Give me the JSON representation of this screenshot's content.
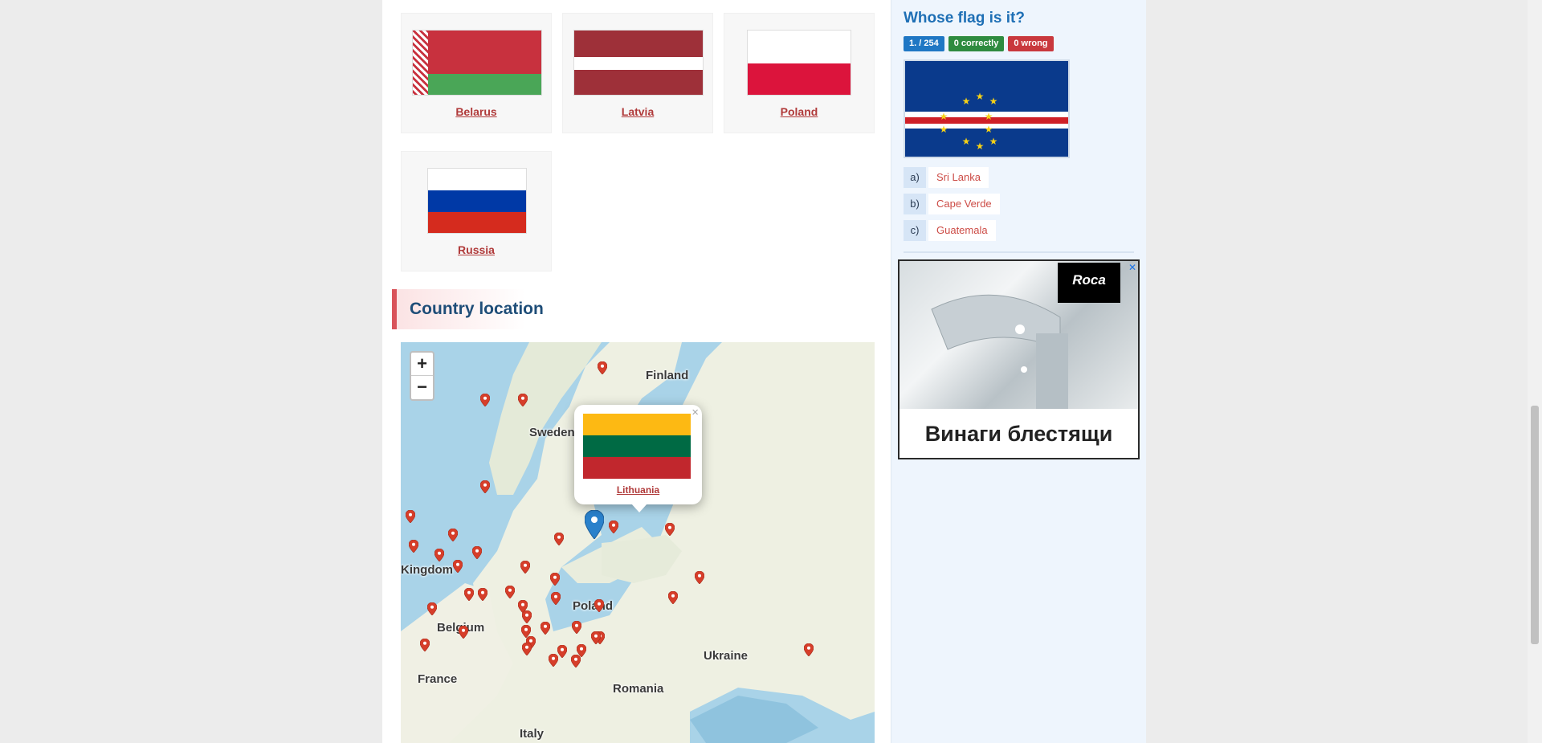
{
  "neighbours": [
    {
      "name": "Belarus",
      "colors": [
        "#c8313e",
        "#4aa657"
      ]
    },
    {
      "name": "Latvia",
      "colors": [
        "#9e3039",
        "#ffffff",
        "#9e3039"
      ]
    },
    {
      "name": "Poland",
      "colors": [
        "#ffffff",
        "#dc143c"
      ]
    },
    {
      "name": "Russia",
      "colors": [
        "#ffffff",
        "#0039a6",
        "#d52b1e"
      ]
    }
  ],
  "section": {
    "title": "Country location"
  },
  "map": {
    "zoom_in": "+",
    "zoom_out": "−",
    "labels": [
      "Finland",
      "Sweden",
      "Kingdom",
      "Belgium",
      "Poland",
      "Ukraine",
      "France",
      "Romania",
      "Italy"
    ],
    "popup": {
      "country": "Lithuania",
      "close": "×",
      "flag_colors": [
        "#fdb913",
        "#006a44",
        "#c1272d"
      ]
    }
  },
  "quiz": {
    "title": "Whose flag is it?",
    "progress": "1. / 254",
    "correct": "0 correctly",
    "wrong": "0 wrong",
    "answers": [
      {
        "letter": "a)",
        "text": "Sri Lanka"
      },
      {
        "letter": "b)",
        "text": "Cape Verde"
      },
      {
        "letter": "c)",
        "text": "Guatemala"
      }
    ]
  },
  "ad": {
    "brand": "Roca",
    "slogan": "Винаги блестящи",
    "close": "✕"
  }
}
